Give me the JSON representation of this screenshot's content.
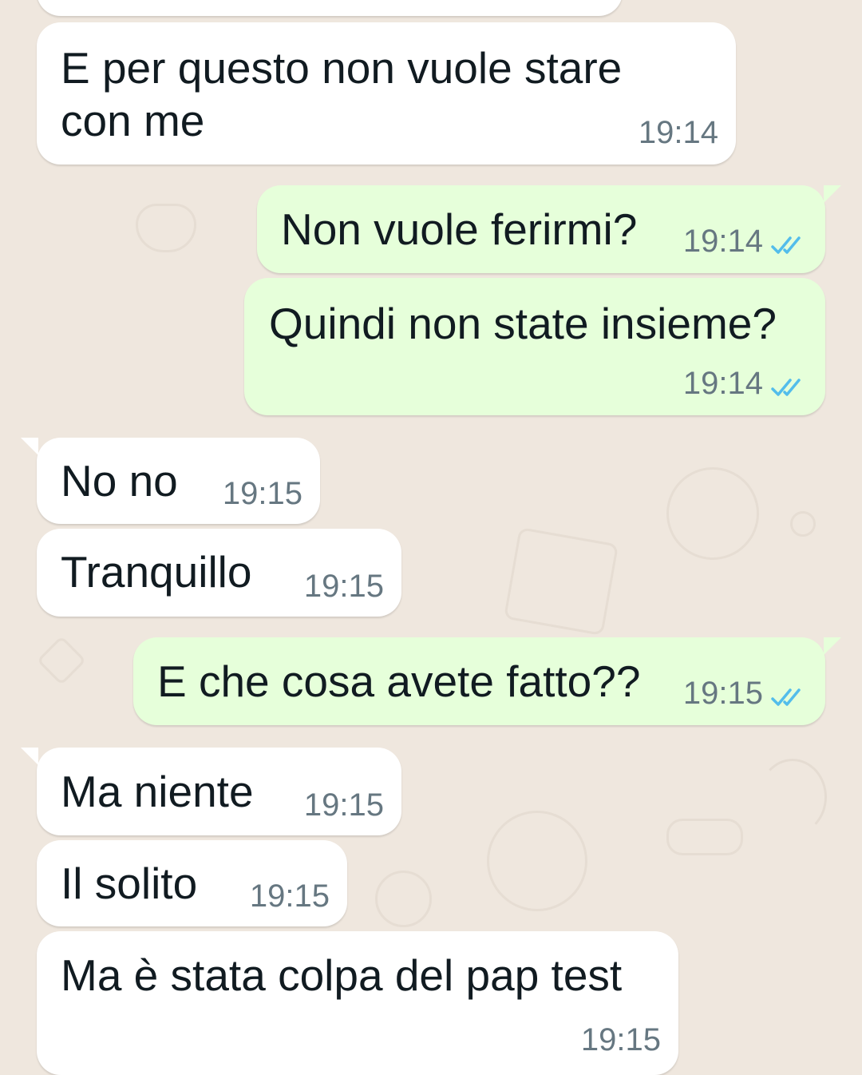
{
  "messages": [
    {
      "id": "m1",
      "direction": "in",
      "text": "E per questo non vuole stare\ncon me",
      "time": "19:14"
    },
    {
      "id": "m2",
      "direction": "out",
      "text": "Non vuole ferirmi?",
      "time": "19:14",
      "status": "read"
    },
    {
      "id": "m3",
      "direction": "out",
      "text": "Quindi non state insieme?",
      "time": "19:14",
      "status": "read"
    },
    {
      "id": "m4",
      "direction": "in",
      "text": "No no",
      "time": "19:15"
    },
    {
      "id": "m5",
      "direction": "in",
      "text": "Tranquillo",
      "time": "19:15"
    },
    {
      "id": "m6",
      "direction": "out",
      "text": "E che cosa avete fatto??",
      "time": "19:15",
      "status": "read"
    },
    {
      "id": "m7",
      "direction": "in",
      "text": "Ma niente",
      "time": "19:15"
    },
    {
      "id": "m8",
      "direction": "in",
      "text": "Il solito",
      "time": "19:15"
    },
    {
      "id": "m9",
      "direction": "in",
      "text": "Ma è stata colpa del pap test",
      "time": "19:15"
    }
  ],
  "colors": {
    "background": "#efe7de",
    "incoming_bubble": "#ffffff",
    "outgoing_bubble": "#e6ffda",
    "timestamp": "#667781",
    "read_ticks": "#53bdeb"
  },
  "icons": {
    "read_receipt": "double-check-icon"
  }
}
